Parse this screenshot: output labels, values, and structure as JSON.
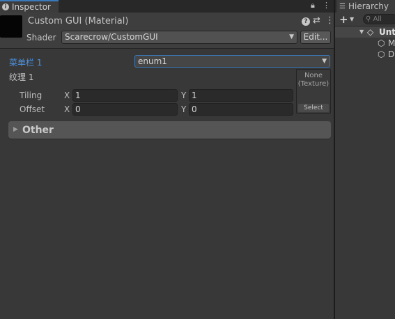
{
  "inspector": {
    "tab_label": "Inspector",
    "tab_icon": "info-icon",
    "material_title": "Custom GUI (Material)",
    "shader_label": "Shader",
    "shader_value": "Scarecrow/CustomGUI",
    "edit_label": "Edit...",
    "properties": {
      "menu_label": "菜单栏 1",
      "menu_value": "enum1",
      "texture_label": "纹理 1",
      "tiling_label": "Tiling",
      "offset_label": "Offset",
      "axis_x": "X",
      "axis_y": "Y",
      "tiling_x": "1",
      "tiling_y": "1",
      "offset_x": "0",
      "offset_y": "0",
      "texture_slot_line1": "None",
      "texture_slot_line2": "(Texture)",
      "texture_select": "Select"
    },
    "other_label": "Other"
  },
  "hierarchy": {
    "tab_label": "Hierarchy",
    "tab_icon": "list-icon",
    "search_placeholder": "All",
    "scene_name": "Unt",
    "objects": [
      "M",
      "D"
    ]
  },
  "colors": {
    "panel_bg": "#383838",
    "accent_blue": "#3a79bb",
    "label_blue": "#4c95e6",
    "field_bg": "#2a2a2a"
  }
}
